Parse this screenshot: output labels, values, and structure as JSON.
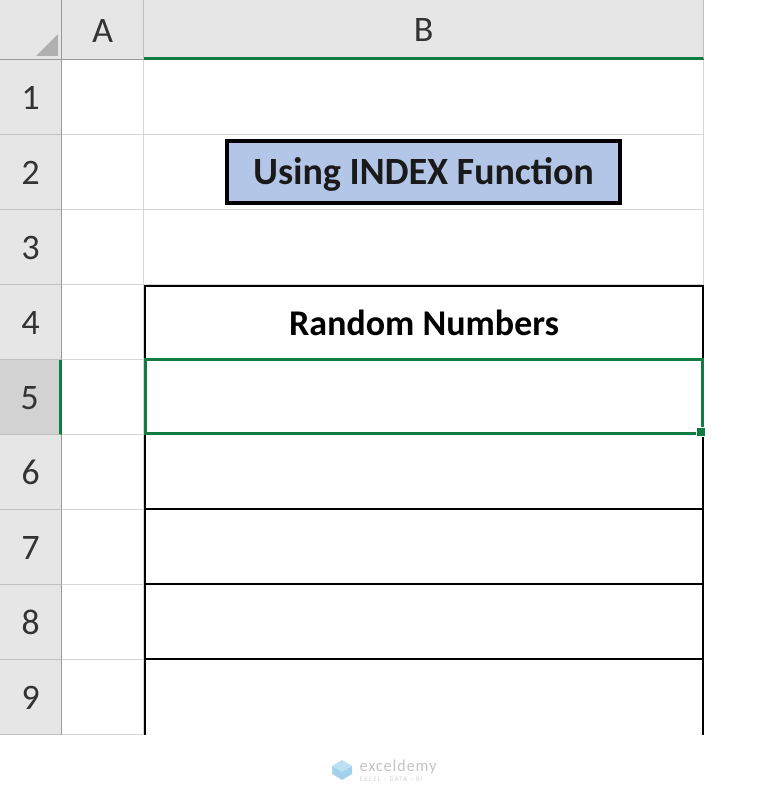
{
  "columns": [
    "A",
    "B"
  ],
  "rows": [
    "1",
    "2",
    "3",
    "4",
    "5",
    "6",
    "7",
    "8",
    "9"
  ],
  "title": "Using INDEX Function",
  "tableHeader": "Random Numbers",
  "selectedCell": {
    "row": 5,
    "col": "B"
  },
  "watermark": {
    "main": "exceldemy",
    "sub": "EXCEL · DATA · BI"
  },
  "chart_data": {
    "type": "table",
    "title": "Using INDEX Function",
    "columns": [
      "Random Numbers"
    ],
    "rows": [
      [
        ""
      ],
      [
        ""
      ],
      [
        ""
      ],
      [
        ""
      ],
      [
        ""
      ]
    ]
  }
}
